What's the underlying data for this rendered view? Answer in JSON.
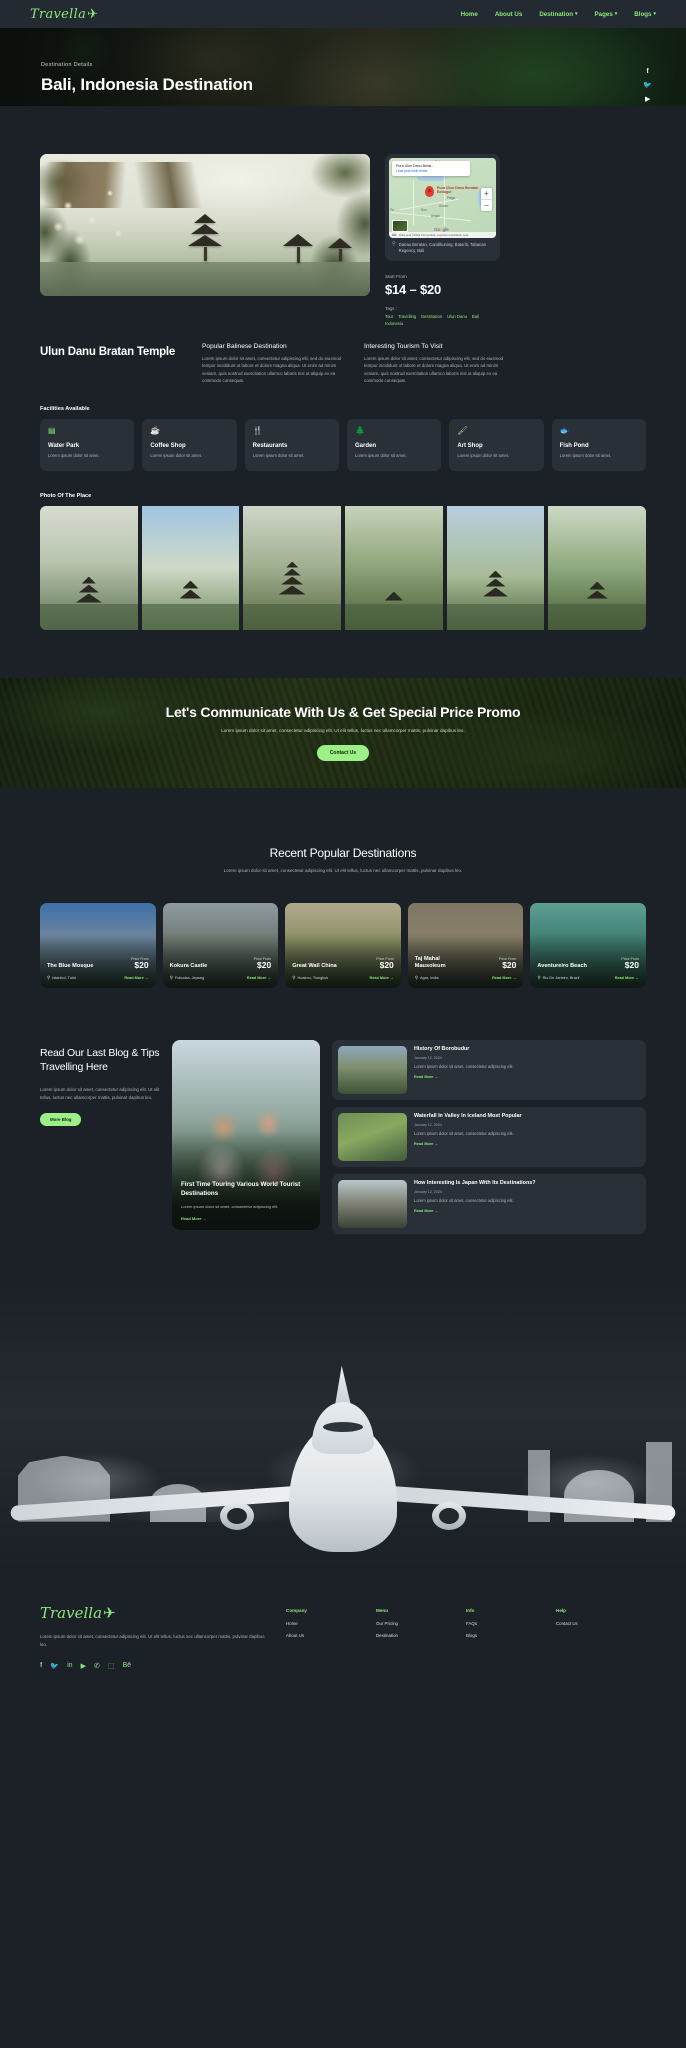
{
  "header": {
    "logo": "Travella",
    "nav": [
      {
        "label": "Home",
        "caret": false
      },
      {
        "label": "About Us",
        "caret": false
      },
      {
        "label": "Destination",
        "caret": true
      },
      {
        "label": "Pages",
        "caret": true
      },
      {
        "label": "Blogs",
        "caret": true
      }
    ]
  },
  "hero": {
    "eyebrow": "Destination Details",
    "title": "Bali, Indonesia Destination",
    "social": [
      "facebook-icon",
      "twitter-icon",
      "youtube-icon"
    ],
    "scroll_icon": "down-arrow-icon"
  },
  "map": {
    "bubble_title": "Pura Ulun Danu Berat...",
    "bubble_link": "Lihat peta lebih besar",
    "pin_label": "Pura Ulun Danu Beratan Bedugul",
    "labels": [
      "Sekeh",
      "Plaga",
      "Aunan",
      "Bon",
      "Angsri",
      "Pa"
    ],
    "google": "Google",
    "attribution": "Data peta ©2024    Persyaratan    Laporkan kesalahan peta",
    "zoom_in": "+",
    "zoom_out": "−",
    "address": "Danau Beratan, Candikuning, Baturiti, Tabanan Regency, Bali"
  },
  "pricing": {
    "start_from_label": "Start From",
    "price": "$14 – $20",
    "tags_label": "Tags :",
    "tags": [
      "Tour",
      "Travelling",
      "Destination",
      "Ulun Danu",
      "Bali",
      "Indonesia"
    ]
  },
  "detail": {
    "place_title": "Ulun Danu Bratan Temple",
    "columns": [
      {
        "heading": "Popular Balinese Destination",
        "text": "Lorem ipsum dolor sit amet, consectetur adipiscing elit, sed do eiusmod tempor incididunt ut labore et dolore magna aliqua. Ut enim ad minim veniam, quis nostrud exercitation ullamco laboris nisi ut aliquip ex ea commodo consequat."
      },
      {
        "heading": "Interesting Tourism To Visit",
        "text": "Lorem ipsum dolor sit amet, consectetur adipiscing elit, sed do eiusmod tempor incididunt ut labore et dolore magna aliqua. Ut enim ad minim veniam, quis nostrud exercitation ullamco laboris nisi ut aliquip ex ea commodo consequat."
      }
    ]
  },
  "facilities": {
    "heading": "Facilities Available",
    "items": [
      {
        "icon": "water-park-icon",
        "glyph": "▤",
        "title": "Water Park",
        "text": "Lorem ipsum dolor sit amet."
      },
      {
        "icon": "coffee-cup-icon",
        "glyph": "☕",
        "title": "Coffee Shop",
        "text": "Lorem ipsum dolor sit amet."
      },
      {
        "icon": "fork-knife-icon",
        "glyph": "🍴",
        "title": "Restaurants",
        "text": "Lorem ipsum dolor sit amet."
      },
      {
        "icon": "tree-icon",
        "glyph": "🌲",
        "title": "Garden",
        "text": "Lorem ipsum dolor sit amet."
      },
      {
        "icon": "paint-brush-icon",
        "glyph": "🖌",
        "title": "Art Shop",
        "text": "Lorem ipsum dolor sit amet."
      },
      {
        "icon": "fish-icon",
        "glyph": "🐟",
        "title": "Fish Pond",
        "text": "Lorem ipsum dolor sit amet."
      }
    ]
  },
  "gallery": {
    "heading": "Photo Of The Place"
  },
  "cta": {
    "title": "Let's Communicate With Us & Get Special Price Promo",
    "subtitle": "Lorem ipsum dolor sit amet, consectetur adipiscing elit. Ut elit tellus, luctus nec ullamcorper mattis, pulvinar dapibus leo.",
    "button": "Contact Us"
  },
  "recent": {
    "title": "Recent Popular Destinations",
    "subtitle": "Lorem ipsum dolor sit amet, consectetur adipiscing elit. Ut elit tellus, luctus nec ullamcorper mattis, pulvinar dapibus leo.",
    "price_from_label": "Price From",
    "read_more": "Read More",
    "cards": [
      {
        "name": "The Blue Mosque",
        "price": "$20",
        "location": "Istanbul, Turki"
      },
      {
        "name": "Kokura Castle",
        "price": "$20",
        "location": "Fukuoka, Jepang"
      },
      {
        "name": "Great Wall China",
        "price": "$20",
        "location": "Huairou, Tiongkok"
      },
      {
        "name": "Taj Mahal Mausoleum",
        "price": "$20",
        "location": "Agra, India"
      },
      {
        "name": "Aventureiro Beach",
        "price": "$20",
        "location": "Rio De Janeiro, Brazil"
      }
    ]
  },
  "blog": {
    "heading": "Read Our Last Blog & Tips Travelling Here",
    "text": "Lorem ipsum dolor sit amet, consectetur adipiscing elit. Ut elit tellus, luctus nec ullamcorper mattis, pulvinar dapibus leo.",
    "button": "More Blog",
    "feature": {
      "title": "First Time Touring Various World Tourist Destinations",
      "text": "Lorem ipsum dolor sit amet, consectetur adipiscing elit.",
      "read_more": "Read More"
    },
    "items": [
      {
        "title": "History Of Borobudur",
        "date": "January 12, 2024",
        "text": "Lorem ipsum dolor sit amet, consectetur adipiscing elit.",
        "read_more": "Read More"
      },
      {
        "title": "Waterfall In Valley In Iceland Most Popular",
        "date": "January 12, 2024",
        "text": "Lorem ipsum dolor sit amet, consectetur adipiscing elit.",
        "read_more": "Read More"
      },
      {
        "title": "How Interesting Is Japan With Its Destinations?",
        "date": "January 12, 2024",
        "text": "Lorem ipsum dolor sit amet, consectetur adipiscing elit.",
        "read_more": "Read More"
      }
    ]
  },
  "footer": {
    "logo": "Travella",
    "text": "Lorem ipsum dolor sit amet, consectetur adipiscing elit. Ut elit tellus, luctus nec ullamcorper mattis, pulvinar dapibus leo.",
    "social": [
      "facebook-icon",
      "twitter-icon",
      "linkedin-icon",
      "youtube-icon",
      "whatsapp-icon",
      "instagram-icon",
      "behance-icon"
    ],
    "columns": [
      {
        "heading": "Company",
        "links": [
          "Home",
          "About Us"
        ]
      },
      {
        "heading": "Menu",
        "links": [
          "Our Pricing",
          "Destination"
        ]
      },
      {
        "heading": "Info",
        "links": [
          "FAQs",
          "Blogs"
        ]
      },
      {
        "heading": "Help",
        "links": [
          "Contact Us"
        ]
      }
    ]
  },
  "colors": {
    "accent": "#8ce87a",
    "button": "#9cf087",
    "background": "#1c2128",
    "card": "#2a3038"
  }
}
